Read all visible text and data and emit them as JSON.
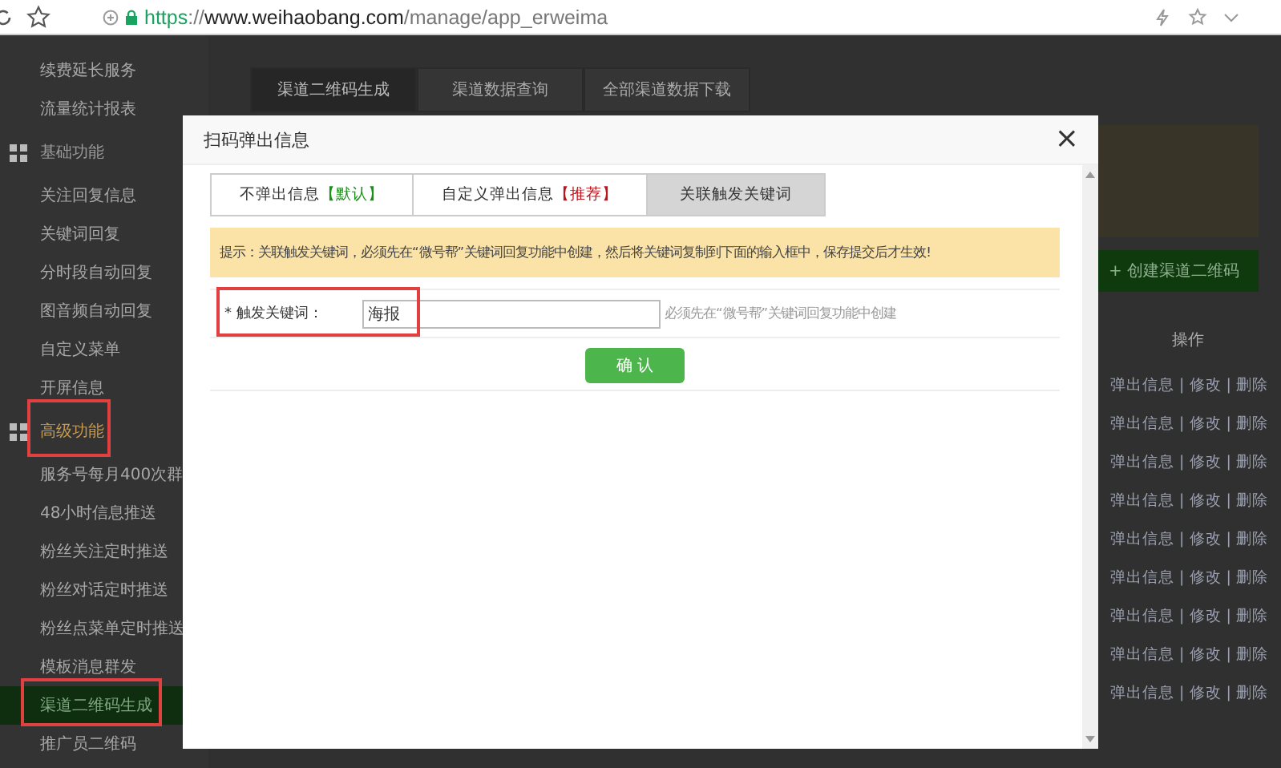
{
  "browser": {
    "url_scheme": "https",
    "url_sep": "://",
    "url_host": "www.weihaobang.com",
    "url_path": "/manage/app_erweima"
  },
  "sidebar": [
    {
      "kind": "item",
      "label": "续费延长服务",
      "selected": false
    },
    {
      "kind": "item",
      "label": "流量统计报表",
      "selected": false
    },
    {
      "kind": "section",
      "label": "基础功能",
      "highlighted": false
    },
    {
      "kind": "item",
      "label": "关注回复信息",
      "selected": false
    },
    {
      "kind": "item",
      "label": "关键词回复",
      "selected": false
    },
    {
      "kind": "item",
      "label": "分时段自动回复",
      "selected": false
    },
    {
      "kind": "item",
      "label": "图音频自动回复",
      "selected": false
    },
    {
      "kind": "item",
      "label": "自定义菜单",
      "selected": false
    },
    {
      "kind": "item",
      "label": "开屏信息",
      "selected": false
    },
    {
      "kind": "section",
      "label": "高级功能",
      "highlighted": true
    },
    {
      "kind": "item",
      "label": "服务号每月400次群",
      "selected": false
    },
    {
      "kind": "item",
      "label": "48小时信息推送",
      "selected": false
    },
    {
      "kind": "item",
      "label": "粉丝关注定时推送",
      "selected": false
    },
    {
      "kind": "item",
      "label": "粉丝对话定时推送",
      "selected": false
    },
    {
      "kind": "item",
      "label": "粉丝点菜单定时推送",
      "selected": false
    },
    {
      "kind": "item",
      "label": "模板消息群发",
      "selected": false
    },
    {
      "kind": "item",
      "label": "渠道二维码生成",
      "selected": true
    },
    {
      "kind": "item",
      "label": "推广员二维码",
      "selected": false
    }
  ],
  "page_tabs": [
    {
      "label": "渠道二维码生成",
      "selected": true
    },
    {
      "label": "渠道数据查询",
      "selected": false
    },
    {
      "label": "全部渠道数据下载",
      "selected": false
    }
  ],
  "create_button": "+ 创建渠道二维码",
  "table": {
    "action_header": "操作",
    "rows": [
      "弹出信息 | 修改 | 删除",
      "弹出信息 | 修改 | 删除",
      "弹出信息 | 修改 | 删除",
      "弹出信息 | 修改 | 删除",
      "弹出信息 | 修改 | 删除",
      "弹出信息 | 修改 | 删除",
      "弹出信息 | 修改 | 删除",
      "弹出信息 | 修改 | 删除",
      "弹出信息 | 修改 | 删除"
    ]
  },
  "dialog": {
    "title": "扫码弹出信息",
    "close": "×",
    "tabs": [
      {
        "label": "不弹出信息",
        "tag": "【默认】",
        "color": "#1a8f1a",
        "selected": false
      },
      {
        "label": "自定义弹出信息",
        "tag": "【推荐】",
        "color": "#c0141c",
        "selected": false
      },
      {
        "label": "关联触发关键词",
        "selected": true
      }
    ],
    "notice": "提示：关联触发关键词，必须先在“微号帮”关键词回复功能中创建，然后将关键词复制到下面的输入框中，保存提交后才生效!",
    "field": {
      "required_mark": "*",
      "label": "触发关键词：",
      "value": "海报",
      "hint": "必须先在“微号帮”关键词回复功能中创建",
      "highlighted": true
    },
    "confirm": "确 认"
  }
}
